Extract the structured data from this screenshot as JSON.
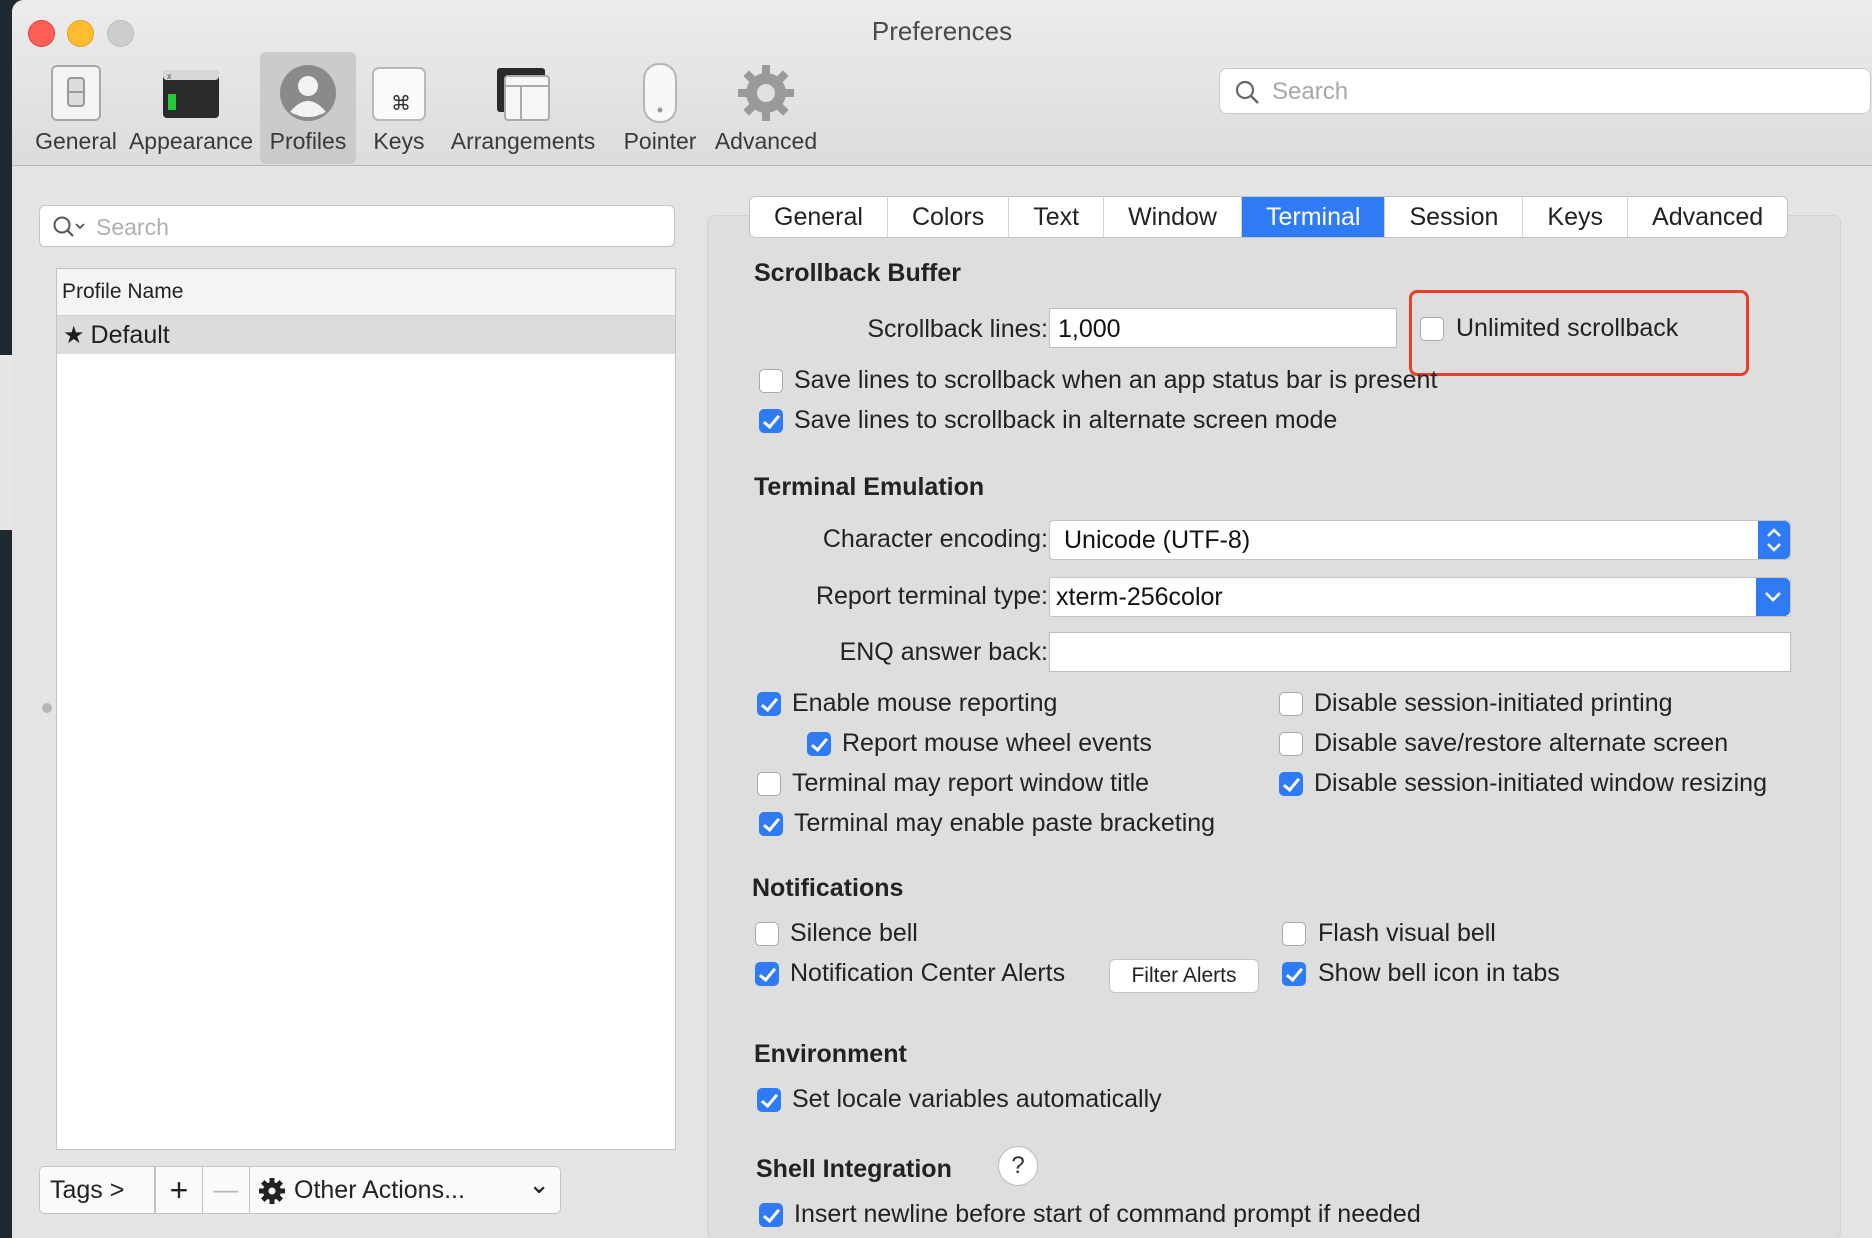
{
  "window": {
    "title": "Preferences"
  },
  "toolbar": {
    "items": [
      {
        "label": "General",
        "icon": "general-switch-icon"
      },
      {
        "label": "Appearance",
        "icon": "appearance-terminal-icon"
      },
      {
        "label": "Profiles",
        "icon": "profiles-person-icon",
        "selected": true
      },
      {
        "label": "Keys",
        "icon": "keys-command-icon"
      },
      {
        "label": "Arrangements",
        "icon": "arrangements-windows-icon"
      },
      {
        "label": "Pointer",
        "icon": "pointer-mouse-icon"
      },
      {
        "label": "Advanced",
        "icon": "advanced-gear-icon"
      }
    ],
    "search_placeholder": "Search"
  },
  "left": {
    "search_placeholder": "Search",
    "list_header": "Profile Name",
    "profiles": [
      {
        "name": "Default",
        "star": "★"
      }
    ],
    "bottom": {
      "tags": "Tags >",
      "add": "+",
      "remove": "—",
      "other_actions": "Other Actions...",
      "chevron": "⌄"
    }
  },
  "tabs": [
    "General",
    "Colors",
    "Text",
    "Window",
    "Terminal",
    "Session",
    "Keys",
    "Advanced"
  ],
  "active_tab": "Terminal",
  "scrollback": {
    "title": "Scrollback Buffer",
    "lines_label": "Scrollback lines:",
    "lines_value": "1,000",
    "unlimited_label": "Unlimited scrollback",
    "unlimited_checked": false,
    "save_status_label": "Save lines to scrollback when an app status bar is present",
    "save_status_checked": false,
    "save_alternate_label": "Save lines to scrollback in alternate screen mode",
    "save_alternate_checked": true
  },
  "emulation": {
    "title": "Terminal Emulation",
    "encoding_label": "Character encoding:",
    "encoding_value": "Unicode (UTF-8)",
    "report_type_label": "Report terminal type:",
    "report_type_value": "xterm-256color",
    "enq_label": "ENQ answer back:",
    "enq_value": "",
    "options": {
      "mouse_reporting": {
        "label": "Enable mouse reporting",
        "checked": true
      },
      "mouse_wheel": {
        "label": "Report mouse wheel events",
        "checked": true
      },
      "window_title": {
        "label": "Terminal may report window title",
        "checked": false
      },
      "paste_bracketing": {
        "label": "Terminal may enable paste bracketing",
        "checked": true
      },
      "disable_printing": {
        "label": "Disable session-initiated printing",
        "checked": false
      },
      "disable_alt_screen": {
        "label": "Disable save/restore alternate screen",
        "checked": false
      },
      "disable_resizing": {
        "label": "Disable session-initiated window resizing",
        "checked": true
      }
    }
  },
  "notifications": {
    "title": "Notifications",
    "silence_bell": {
      "label": "Silence bell",
      "checked": false
    },
    "nc_alerts": {
      "label": "Notification Center Alerts",
      "checked": true
    },
    "filter_alerts_button": "Filter Alerts",
    "flash_bell": {
      "label": "Flash visual bell",
      "checked": false
    },
    "bell_icon": {
      "label": "Show bell icon in tabs",
      "checked": true
    }
  },
  "environment": {
    "title": "Environment",
    "locale": {
      "label": "Set locale variables automatically",
      "checked": true
    }
  },
  "shell_integration": {
    "title": "Shell Integration",
    "help": "?",
    "newline": {
      "label": "Insert newline before start of command prompt if needed",
      "checked": true
    }
  },
  "colors": {
    "accent": "#2f7bf6",
    "highlight": "#e8402b"
  }
}
